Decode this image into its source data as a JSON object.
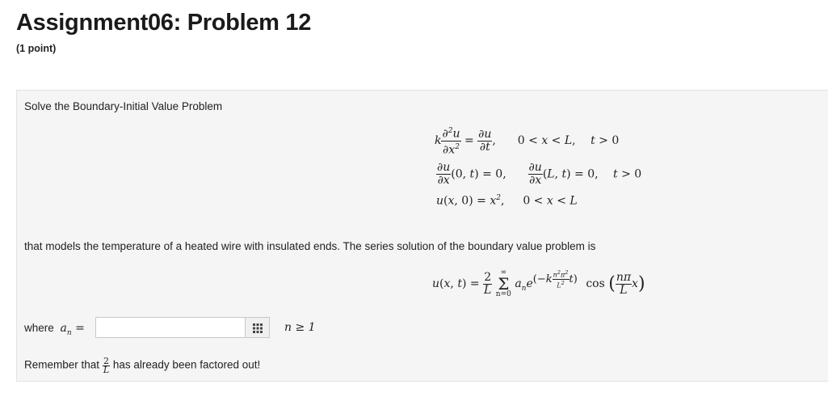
{
  "header": {
    "title": "Assignment06: Problem 12",
    "points": "(1 point)"
  },
  "problem": {
    "intro": "Solve the Boundary-Initial Value Problem",
    "description": "that models the temperature of a heated wire with insulated ends. The series solution of the boundary value problem is",
    "where_label": "where",
    "answer_value": "",
    "condition": "n ≥ 1",
    "remember_before": "Remember that",
    "remember_after": "has already been factored out!"
  },
  "icons": {
    "equation_editor": "grid-icon"
  }
}
